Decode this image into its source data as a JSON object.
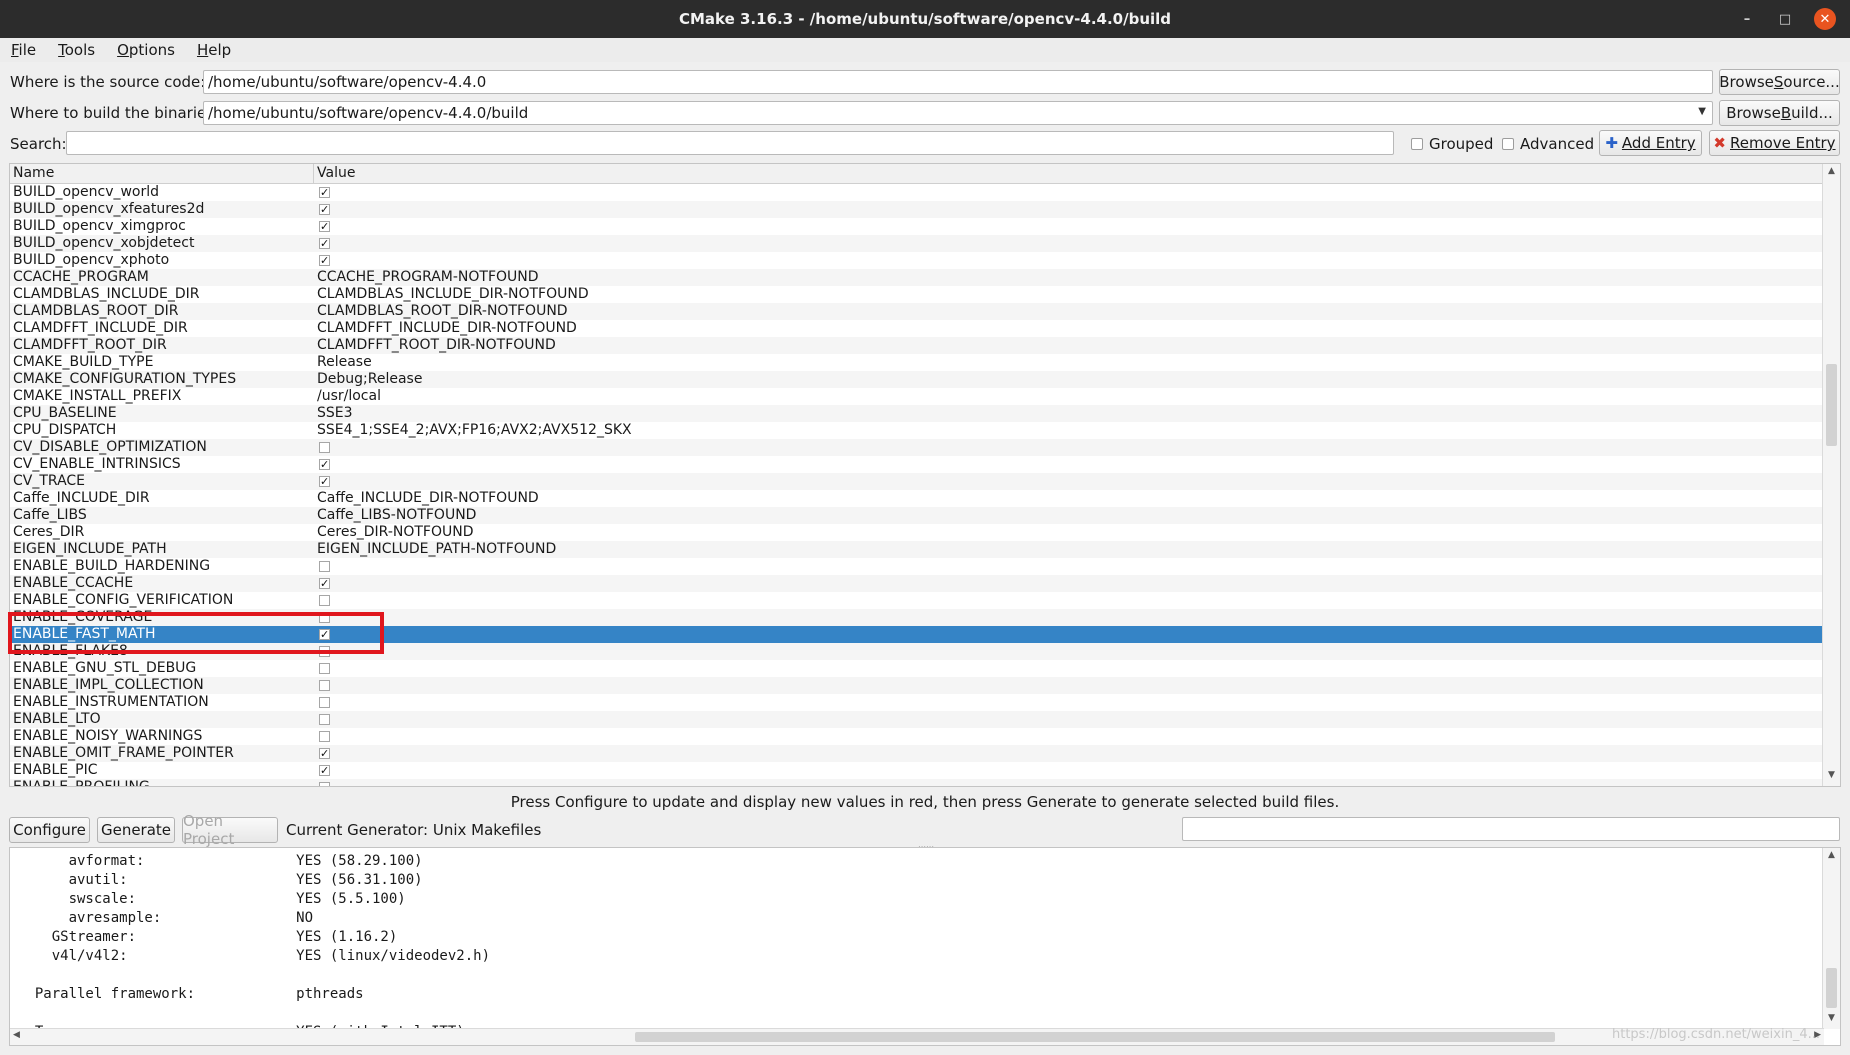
{
  "window": {
    "title": "CMake 3.16.3 - /home/ubuntu/software/opencv-4.4.0/build"
  },
  "menu": [
    {
      "mn": "F",
      "rest": "ile"
    },
    {
      "mn": "T",
      "rest": "ools"
    },
    {
      "mn": "O",
      "rest": "ptions"
    },
    {
      "mn": "H",
      "rest": "elp"
    }
  ],
  "source": {
    "label": "Where is the source code:",
    "value": "/home/ubuntu/software/opencv-4.4.0",
    "browse_pre": "Browse ",
    "browse_mn": "S",
    "browse_post": "ource..."
  },
  "build": {
    "label": "Where to build the binaries:",
    "value": "/home/ubuntu/software/opencv-4.4.0/build",
    "browse_pre": "Browse ",
    "browse_mn": "B",
    "browse_post": "uild..."
  },
  "search": {
    "label": "Search:",
    "value": "",
    "grouped": "Grouped",
    "advanced": "Advanced",
    "add_entry": "Add Entry",
    "remove_entry": "Remove Entry"
  },
  "table": {
    "headers": {
      "name": "Name",
      "value": "Value"
    },
    "selected_index": 26,
    "rows": [
      {
        "name": "BUILD_opencv_world",
        "type": "bool",
        "checked": true
      },
      {
        "name": "BUILD_opencv_xfeatures2d",
        "type": "bool",
        "checked": true
      },
      {
        "name": "BUILD_opencv_ximgproc",
        "type": "bool",
        "checked": true
      },
      {
        "name": "BUILD_opencv_xobjdetect",
        "type": "bool",
        "checked": true
      },
      {
        "name": "BUILD_opencv_xphoto",
        "type": "bool",
        "checked": true
      },
      {
        "name": "CCACHE_PROGRAM",
        "type": "text",
        "value": "CCACHE_PROGRAM-NOTFOUND"
      },
      {
        "name": "CLAMDBLAS_INCLUDE_DIR",
        "type": "text",
        "value": "CLAMDBLAS_INCLUDE_DIR-NOTFOUND"
      },
      {
        "name": "CLAMDBLAS_ROOT_DIR",
        "type": "text",
        "value": "CLAMDBLAS_ROOT_DIR-NOTFOUND"
      },
      {
        "name": "CLAMDFFT_INCLUDE_DIR",
        "type": "text",
        "value": "CLAMDFFT_INCLUDE_DIR-NOTFOUND"
      },
      {
        "name": "CLAMDFFT_ROOT_DIR",
        "type": "text",
        "value": "CLAMDFFT_ROOT_DIR-NOTFOUND"
      },
      {
        "name": "CMAKE_BUILD_TYPE",
        "type": "text",
        "value": "Release"
      },
      {
        "name": "CMAKE_CONFIGURATION_TYPES",
        "type": "text",
        "value": "Debug;Release"
      },
      {
        "name": "CMAKE_INSTALL_PREFIX",
        "type": "text",
        "value": "/usr/local"
      },
      {
        "name": "CPU_BASELINE",
        "type": "text",
        "value": "SSE3"
      },
      {
        "name": "CPU_DISPATCH",
        "type": "text",
        "value": "SSE4_1;SSE4_2;AVX;FP16;AVX2;AVX512_SKX"
      },
      {
        "name": "CV_DISABLE_OPTIMIZATION",
        "type": "bool",
        "checked": false
      },
      {
        "name": "CV_ENABLE_INTRINSICS",
        "type": "bool",
        "checked": true
      },
      {
        "name": "CV_TRACE",
        "type": "bool",
        "checked": true
      },
      {
        "name": "Caffe_INCLUDE_DIR",
        "type": "text",
        "value": "Caffe_INCLUDE_DIR-NOTFOUND"
      },
      {
        "name": "Caffe_LIBS",
        "type": "text",
        "value": "Caffe_LIBS-NOTFOUND"
      },
      {
        "name": "Ceres_DIR",
        "type": "text",
        "value": "Ceres_DIR-NOTFOUND"
      },
      {
        "name": "EIGEN_INCLUDE_PATH",
        "type": "text",
        "value": "EIGEN_INCLUDE_PATH-NOTFOUND"
      },
      {
        "name": "ENABLE_BUILD_HARDENING",
        "type": "bool",
        "checked": false
      },
      {
        "name": "ENABLE_CCACHE",
        "type": "bool",
        "checked": true
      },
      {
        "name": "ENABLE_CONFIG_VERIFICATION",
        "type": "bool",
        "checked": false
      },
      {
        "name": "ENABLE_COVERAGE",
        "type": "bool",
        "checked": false
      },
      {
        "name": "ENABLE_FAST_MATH",
        "type": "bool",
        "checked": true
      },
      {
        "name": "ENABLE_FLAKE8",
        "type": "bool",
        "checked": false
      },
      {
        "name": "ENABLE_GNU_STL_DEBUG",
        "type": "bool",
        "checked": false
      },
      {
        "name": "ENABLE_IMPL_COLLECTION",
        "type": "bool",
        "checked": false
      },
      {
        "name": "ENABLE_INSTRUMENTATION",
        "type": "bool",
        "checked": false
      },
      {
        "name": "ENABLE_LTO",
        "type": "bool",
        "checked": false
      },
      {
        "name": "ENABLE_NOISY_WARNINGS",
        "type": "bool",
        "checked": false
      },
      {
        "name": "ENABLE_OMIT_FRAME_POINTER",
        "type": "bool",
        "checked": true
      },
      {
        "name": "ENABLE_PIC",
        "type": "bool",
        "checked": true
      },
      {
        "name": "ENABLE_PROFILING",
        "type": "bool",
        "checked": false
      }
    ]
  },
  "hint": "Press Configure to update and display new values in red, then press Generate to generate selected build files.",
  "actions": {
    "configure": "Configure",
    "generate": "Generate",
    "open_project": "Open Project",
    "generator": "Current Generator: Unix Makefiles"
  },
  "output_lines": [
    "      avformat:                  YES (58.29.100)",
    "      avutil:                    YES (56.31.100)",
    "      swscale:                   YES (5.5.100)",
    "      avresample:                NO",
    "    GStreamer:                   YES (1.16.2)",
    "    v4l/v4l2:                    YES (linux/videodev2.h)",
    "",
    "  Parallel framework:            pthreads",
    "",
    "  Trace:                         YES (with Intel ITT)"
  ],
  "watermark": "https://blog.csdn.net/weixin_4..."
}
